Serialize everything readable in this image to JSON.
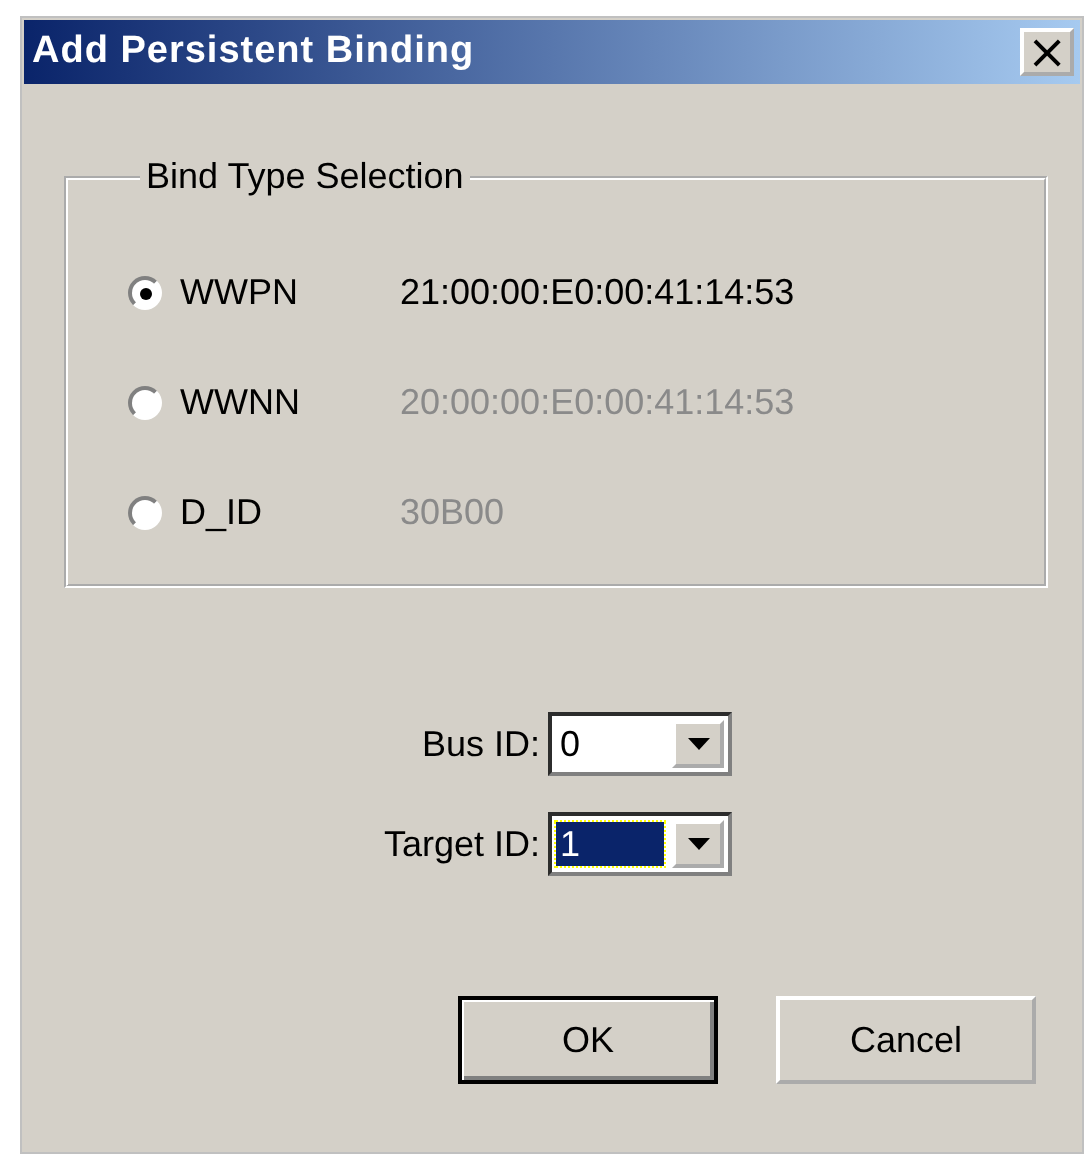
{
  "window": {
    "title": "Add Persistent Binding",
    "close": "×"
  },
  "bind_type": {
    "title": "Bind Type Selection",
    "options": [
      {
        "label": "WWPN",
        "value": "21:00:00:E0:00:41:14:53",
        "selected": true,
        "disabled": false
      },
      {
        "label": "WWNN",
        "value": "20:00:00:E0:00:41:14:53",
        "selected": false,
        "disabled": true
      },
      {
        "label": "D_ID",
        "value": "30B00",
        "selected": false,
        "disabled": true
      }
    ]
  },
  "fields": [
    {
      "label": "Bus ID:",
      "value": "0",
      "focused": false
    },
    {
      "label": "Target ID:",
      "value": "1",
      "focused": true
    }
  ],
  "buttons": [
    {
      "label": "OK",
      "default": true
    },
    {
      "label": "Cancel",
      "default": false
    }
  ]
}
